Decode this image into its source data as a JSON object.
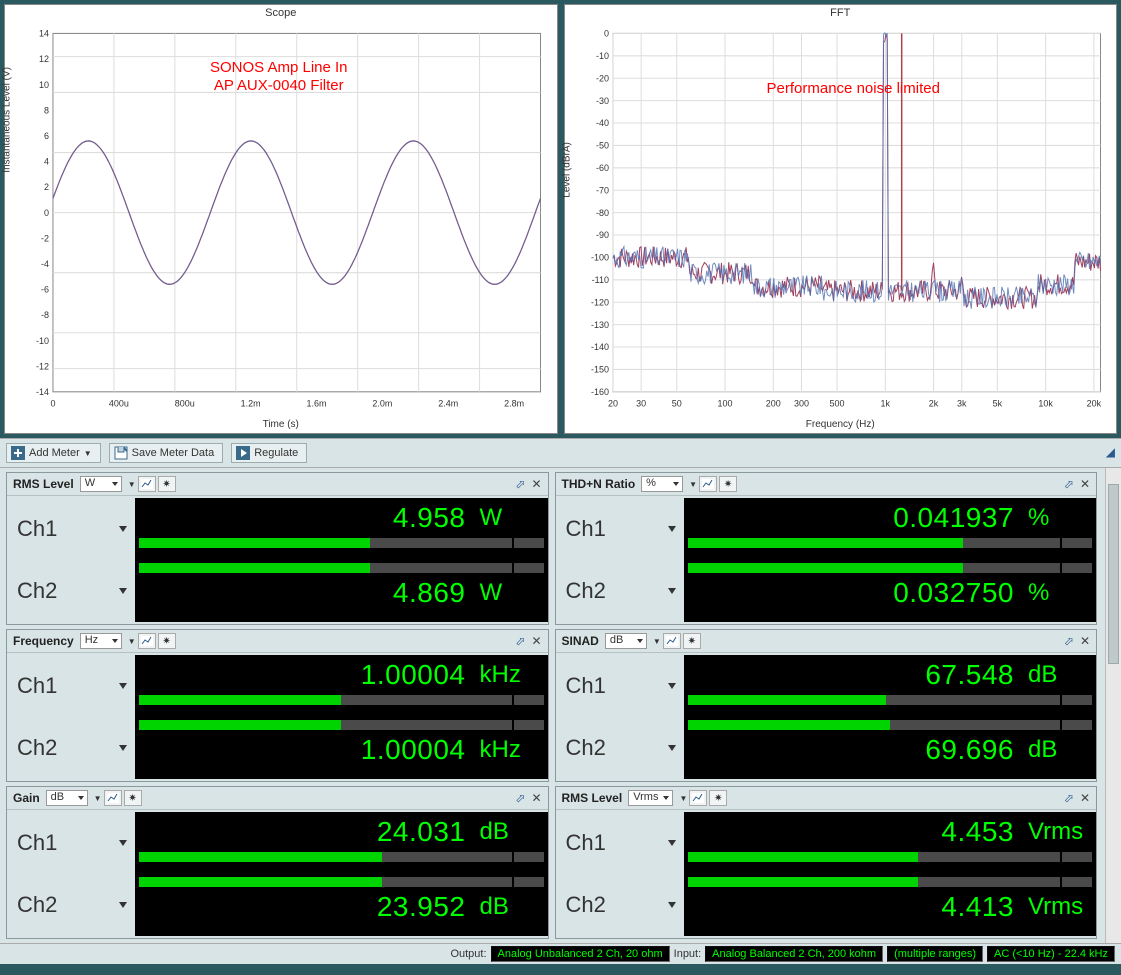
{
  "scope": {
    "title": "Scope",
    "xlabel": "Time (s)",
    "ylabel": "Instantaneous Level (V)",
    "annotation1": "SONOS Amp Line In",
    "annotation2": "AP AUX-0040 Filter",
    "x_ticks": [
      "0",
      "400u",
      "800u",
      "1.2m",
      "1.6m",
      "2.0m",
      "2.4m",
      "2.8m"
    ],
    "y_ticks": [
      "-14",
      "-12",
      "-10",
      "-8",
      "-6",
      "-4",
      "-2",
      "0",
      "2",
      "4",
      "6",
      "8",
      "10",
      "12",
      "14"
    ]
  },
  "fft": {
    "title": "FFT",
    "xlabel": "Frequency (Hz)",
    "ylabel": "Level (dBrA)",
    "annotation": "Performance noise limited",
    "x_ticks": [
      "20",
      "30",
      "50",
      "100",
      "200",
      "300",
      "500",
      "1k",
      "2k",
      "3k",
      "5k",
      "10k",
      "20k"
    ],
    "y_ticks": [
      "-160",
      "-150",
      "-140",
      "-130",
      "-120",
      "-110",
      "-100",
      "-90",
      "-80",
      "-70",
      "-60",
      "-50",
      "-40",
      "-30",
      "-20",
      "-10",
      "0"
    ]
  },
  "toolbar": {
    "add_meter": "Add Meter",
    "save_meter": "Save Meter Data",
    "regulate": "Regulate"
  },
  "meters": [
    {
      "name": "RMS Level",
      "unit": "W",
      "ch1": {
        "label": "Ch1",
        "value": "4.958",
        "unit": "W",
        "bar": 0.57
      },
      "ch2": {
        "label": "Ch2",
        "value": "4.869",
        "unit": "W",
        "bar": 0.57
      }
    },
    {
      "name": "THD+N Ratio",
      "unit": "%",
      "ch1": {
        "label": "Ch1",
        "value": "0.041937",
        "unit": "%",
        "bar": 0.68
      },
      "ch2": {
        "label": "Ch2",
        "value": "0.032750",
        "unit": "%",
        "bar": 0.68
      }
    },
    {
      "name": "Frequency",
      "unit": "Hz",
      "ch1": {
        "label": "Ch1",
        "value": "1.00004",
        "unit": "kHz",
        "bar": 0.5
      },
      "ch2": {
        "label": "Ch2",
        "value": "1.00004",
        "unit": "kHz",
        "bar": 0.5
      }
    },
    {
      "name": "SINAD",
      "unit": "dB",
      "ch1": {
        "label": "Ch1",
        "value": "67.548",
        "unit": "dB",
        "bar": 0.49
      },
      "ch2": {
        "label": "Ch2",
        "value": "69.696",
        "unit": "dB",
        "bar": 0.5
      }
    },
    {
      "name": "Gain",
      "unit": "dB",
      "ch1": {
        "label": "Ch1",
        "value": "24.031",
        "unit": "dB",
        "bar": 0.6
      },
      "ch2": {
        "label": "Ch2",
        "value": "23.952",
        "unit": "dB",
        "bar": 0.6
      }
    },
    {
      "name": "RMS Level",
      "unit": "Vrms",
      "ch1": {
        "label": "Ch1",
        "value": "4.453",
        "unit": "Vrms",
        "bar": 0.57
      },
      "ch2": {
        "label": "Ch2",
        "value": "4.413",
        "unit": "Vrms",
        "bar": 0.57
      }
    }
  ],
  "status": {
    "output_label": "Output:",
    "output_value": "Analog Unbalanced 2 Ch, 20 ohm",
    "input_label": "Input:",
    "input_value": "Analog Balanced 2 Ch, 200 kohm",
    "ranges": "(multiple ranges)",
    "coupling": "AC (<10 Hz) - 22.4 kHz"
  },
  "chart_data": [
    {
      "type": "line",
      "title": "Scope",
      "xlabel": "Time (s)",
      "ylabel": "Instantaneous Level (V)",
      "xlim": [
        0,
        0.003
      ],
      "ylim": [
        -15,
        15
      ],
      "x": [
        0,
        0.0001,
        0.0002,
        0.0003,
        0.0004,
        0.0005,
        0.0006,
        0.0007,
        0.0008,
        0.0009,
        0.001,
        0.0011,
        0.0012,
        0.0013,
        0.0014,
        0.0015,
        0.0016,
        0.0017,
        0.0018,
        0.0019,
        0.002,
        0.0021,
        0.0022,
        0.0023,
        0.0024,
        0.0025,
        0.0026,
        0.0027,
        0.0028,
        0.0029,
        0.003
      ],
      "series": [
        {
          "name": "Ch1",
          "color": "#b04050",
          "values": [
            1.0,
            4.5,
            6.1,
            6.3,
            5.0,
            2.3,
            -1.0,
            -4.2,
            -6.0,
            -6.3,
            -5.2,
            -2.6,
            0.7,
            4.1,
            5.9,
            6.3,
            5.3,
            2.8,
            -0.6,
            -3.9,
            -5.9,
            -6.3,
            -5.4,
            -3.0,
            0.4,
            3.7,
            5.8,
            6.3,
            5.5,
            3.2,
            -0.2
          ]
        },
        {
          "name": "Ch2",
          "color": "#4060b0",
          "values": [
            1.0,
            4.5,
            6.1,
            6.3,
            5.0,
            2.3,
            -1.0,
            -4.2,
            -6.0,
            -6.3,
            -5.2,
            -2.6,
            0.7,
            4.1,
            5.9,
            6.3,
            5.3,
            2.8,
            -0.6,
            -3.9,
            -5.9,
            -6.3,
            -5.4,
            -3.0,
            0.4,
            3.7,
            5.8,
            6.3,
            5.5,
            3.2,
            -0.2
          ]
        }
      ],
      "annotations": [
        "SONOS Amp Line In",
        "AP AUX-0040 Filter"
      ]
    },
    {
      "type": "line",
      "title": "FFT",
      "xlabel": "Frequency (Hz)",
      "ylabel": "Level (dBrA)",
      "xscale": "log",
      "xlim": [
        20,
        22000
      ],
      "ylim": [
        -160,
        0
      ],
      "series": [
        {
          "name": "Ch1",
          "color": "#b04050",
          "noise_floor_approx": -115,
          "peak": {
            "freq": 1000,
            "level": 0
          }
        },
        {
          "name": "Ch2",
          "color": "#4060b0",
          "noise_floor_approx": -115,
          "peak": {
            "freq": 1000,
            "level": 0
          }
        }
      ],
      "annotations": [
        "Performance noise limited"
      ]
    }
  ]
}
